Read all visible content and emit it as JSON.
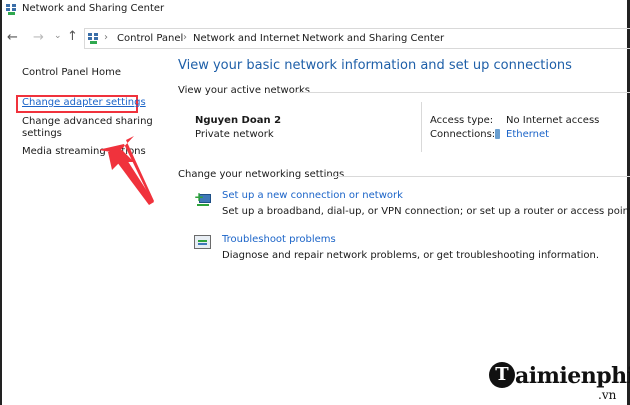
{
  "window": {
    "title": "Network and Sharing Center"
  },
  "address_bar": {
    "crumbs": [
      "Control Panel",
      "Network and Internet",
      "Network and Sharing Center"
    ],
    "separator": "›"
  },
  "nav": {
    "back": "←",
    "forward": "→",
    "recent": "⌄",
    "up": "↑"
  },
  "sidebar": {
    "items": [
      {
        "label": "Control Panel Home"
      },
      {
        "label": "Change adapter settings"
      },
      {
        "label": "Change advanced sharing"
      },
      {
        "label": "settings"
      },
      {
        "label": "Media streaming options"
      }
    ]
  },
  "main": {
    "title": "View your basic network information and set up connections",
    "active_heading": "View your active networks",
    "network_name": "Nguyen Doan 2",
    "network_type": "Private network",
    "access_label": "Access type:",
    "access_value": "No Internet access",
    "connections_label": "Connections:",
    "connections_value": "Ethernet",
    "settings_heading": "Change your networking settings",
    "tasks": [
      {
        "link": "Set up a new connection or network",
        "desc": "Set up a broadband, dial-up, or VPN connection; or set up a router or access point."
      },
      {
        "link": "Troubleshoot problems",
        "desc": "Diagnose and repair network problems, or get troubleshooting information."
      }
    ]
  },
  "watermark": {
    "brand": "aimienphi",
    "initial": "T",
    "tld": ".vn"
  },
  "colors": {
    "highlight": "#f0323c",
    "link": "#1b64c8",
    "title": "#1e5fa8"
  }
}
